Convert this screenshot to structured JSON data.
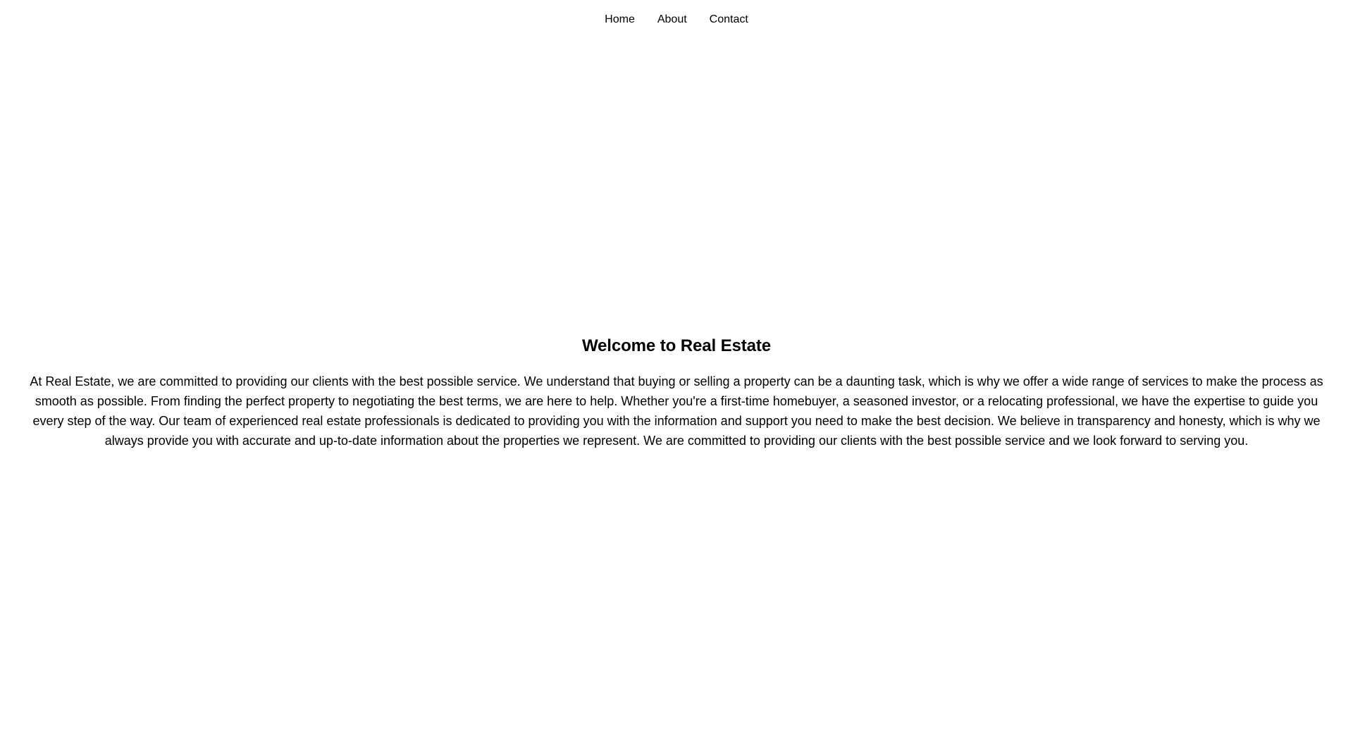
{
  "nav": {
    "items": [
      {
        "label": "Home"
      },
      {
        "label": "About"
      },
      {
        "label": "Contact"
      }
    ]
  },
  "hero": {
    "title": "Welcome to Real Estate",
    "body": "At Real Estate, we are committed to providing our clients with the best possible service. We understand that buying or selling a property can be a daunting task, which is why we offer a wide range of services to make the process as smooth as possible. From finding the perfect property to negotiating the best terms, we are here to help. Whether you're a first-time homebuyer, a seasoned investor, or a relocating professional, we have the expertise to guide you every step of the way. Our team of experienced real estate professionals is dedicated to providing you with the information and support you need to make the best decision. We believe in transparency and honesty, which is why we always provide you with accurate and up-to-date information about the properties we represent. We are committed to providing our clients with the best possible service and we look forward to serving you."
  }
}
